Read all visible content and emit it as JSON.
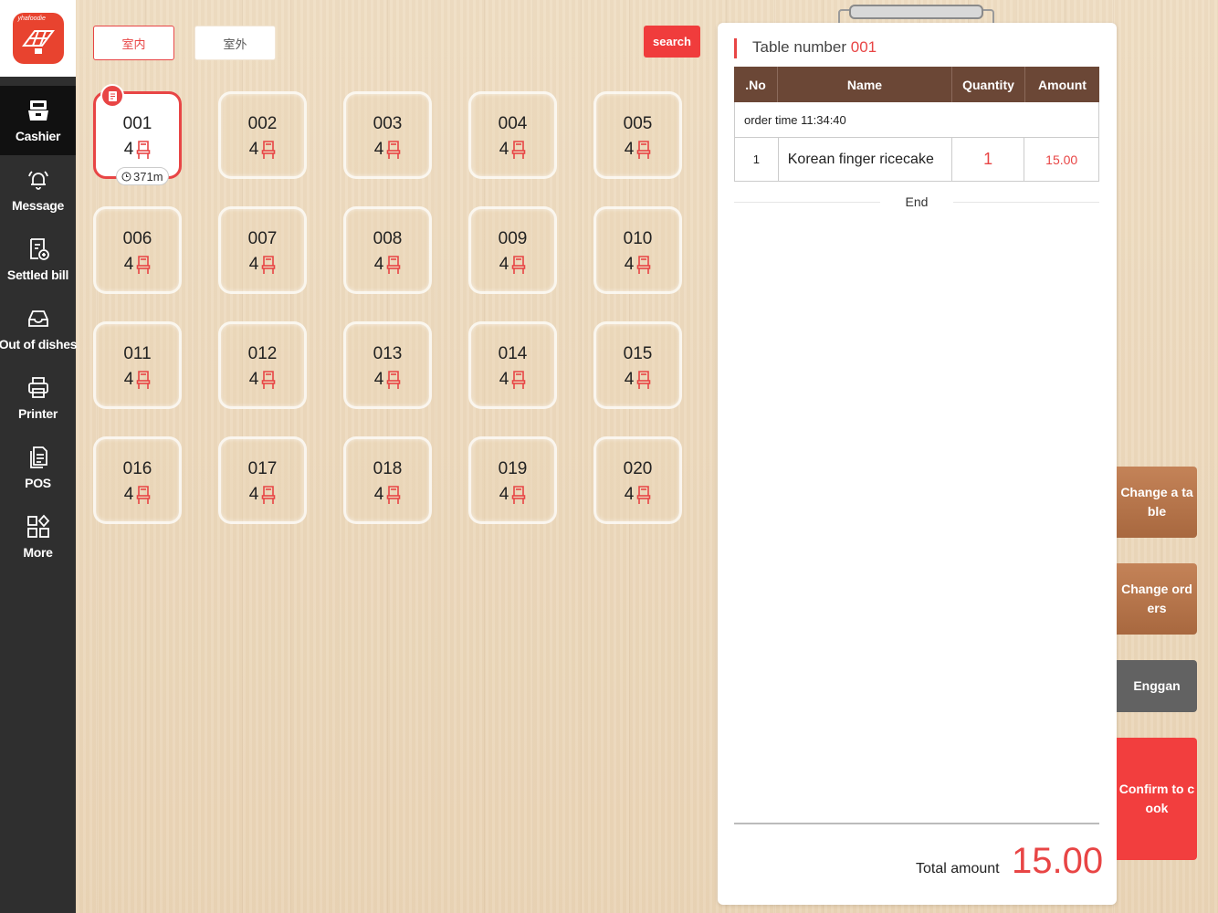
{
  "sidebar": {
    "logo_text": "yhafoodie",
    "items": [
      {
        "label": "Cashier",
        "icon": "cashier-icon",
        "active": true
      },
      {
        "label": "Message",
        "icon": "bell-icon",
        "active": false
      },
      {
        "label": "Settled bill",
        "icon": "bill-icon",
        "active": false
      },
      {
        "label": "Out of dishes",
        "icon": "tray-icon",
        "active": false
      },
      {
        "label": "Printer",
        "icon": "printer-icon",
        "active": false
      },
      {
        "label": "POS",
        "icon": "document-icon",
        "active": false
      },
      {
        "label": "More",
        "icon": "grid-icon",
        "active": false
      }
    ]
  },
  "toolbar": {
    "indoor_label": "室内",
    "outdoor_label": "室外",
    "search_label": "search"
  },
  "tables": [
    {
      "number": "001",
      "seats": "4",
      "occupied": true,
      "timer": "371m"
    },
    {
      "number": "002",
      "seats": "4",
      "occupied": false
    },
    {
      "number": "003",
      "seats": "4",
      "occupied": false
    },
    {
      "number": "004",
      "seats": "4",
      "occupied": false
    },
    {
      "number": "005",
      "seats": "4",
      "occupied": false
    },
    {
      "number": "006",
      "seats": "4",
      "occupied": false
    },
    {
      "number": "007",
      "seats": "4",
      "occupied": false
    },
    {
      "number": "008",
      "seats": "4",
      "occupied": false
    },
    {
      "number": "009",
      "seats": "4",
      "occupied": false
    },
    {
      "number": "010",
      "seats": "4",
      "occupied": false
    },
    {
      "number": "011",
      "seats": "4",
      "occupied": false
    },
    {
      "number": "012",
      "seats": "4",
      "occupied": false
    },
    {
      "number": "013",
      "seats": "4",
      "occupied": false
    },
    {
      "number": "014",
      "seats": "4",
      "occupied": false
    },
    {
      "number": "015",
      "seats": "4",
      "occupied": false
    },
    {
      "number": "016",
      "seats": "4",
      "occupied": false
    },
    {
      "number": "017",
      "seats": "4",
      "occupied": false
    },
    {
      "number": "018",
      "seats": "4",
      "occupied": false
    },
    {
      "number": "019",
      "seats": "4",
      "occupied": false
    },
    {
      "number": "020",
      "seats": "4",
      "occupied": false
    }
  ],
  "receipt": {
    "title_prefix": "Table number",
    "table_number": "001",
    "columns": [
      ".No",
      "Name",
      "Quantity",
      "Amount"
    ],
    "order_time": "order time 11:34:40",
    "rows": [
      {
        "no": "1",
        "name": "Korean finger ricecake",
        "quantity": "1",
        "amount": "15.00"
      }
    ],
    "end_label": "End",
    "total_label": "Total amount",
    "total_value": "15.00"
  },
  "actions": {
    "change_table": "Change a table",
    "change_orders": "Change orders",
    "enggan": "Enggan",
    "confirm_cook": "Confirm to cook"
  },
  "colors": {
    "accent_red": "#e84545",
    "header_brown": "#6b4736",
    "sidebar_dark": "#2f2f2f"
  }
}
